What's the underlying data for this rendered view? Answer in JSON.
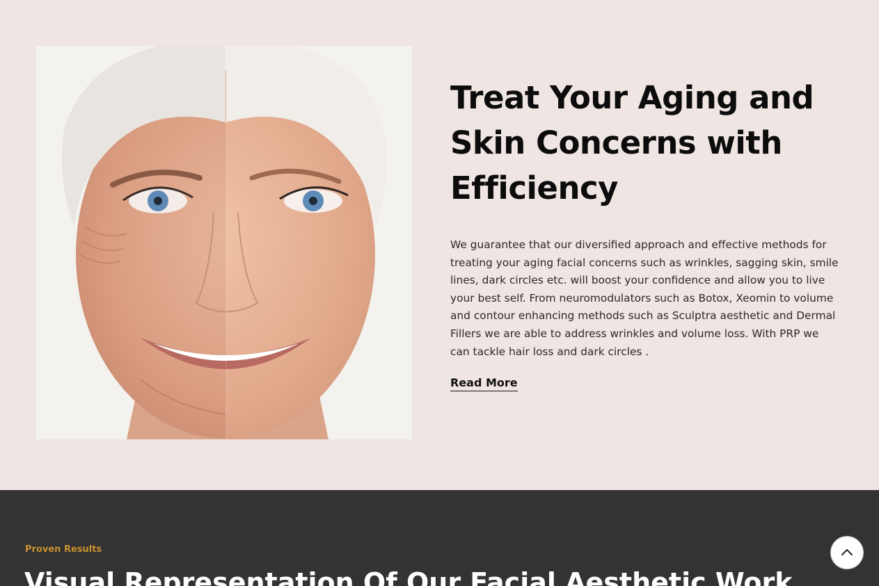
{
  "hero": {
    "title_lines": [
      "Treat Your Aging and",
      "Skin Concerns with",
      "Efficiency"
    ],
    "body_lines": [
      "We guarantee that our diversified approach and effective methods for",
      "treating your aging facial concerns such as wrinkles, sagging skin, smile",
      "lines, dark circles etc. will boost your confidence and allow you to live",
      "your best self. From neuromodulators such as Botox, Xeomin to volume",
      "and contour enhancing methods such as Sculptra aesthetic and Dermal",
      "Fillers we are able to address wrinkles and volume loss. With PRP we",
      "can tackle hair loss and dark circles ."
    ],
    "read_more_label": "Read More",
    "image_icon": "portrait-before-after-image"
  },
  "results": {
    "eyebrow": "Proven Results",
    "title": "Visual Representation Of Our Facial Aesthetic Work"
  },
  "scroll_top": {
    "icon": "chevron-up-icon"
  },
  "colors": {
    "hero_bg": "#efe5e3",
    "dark_section_bg": "#333333",
    "accent_gold": "#c8912f",
    "heading": "#0c0c0c"
  }
}
